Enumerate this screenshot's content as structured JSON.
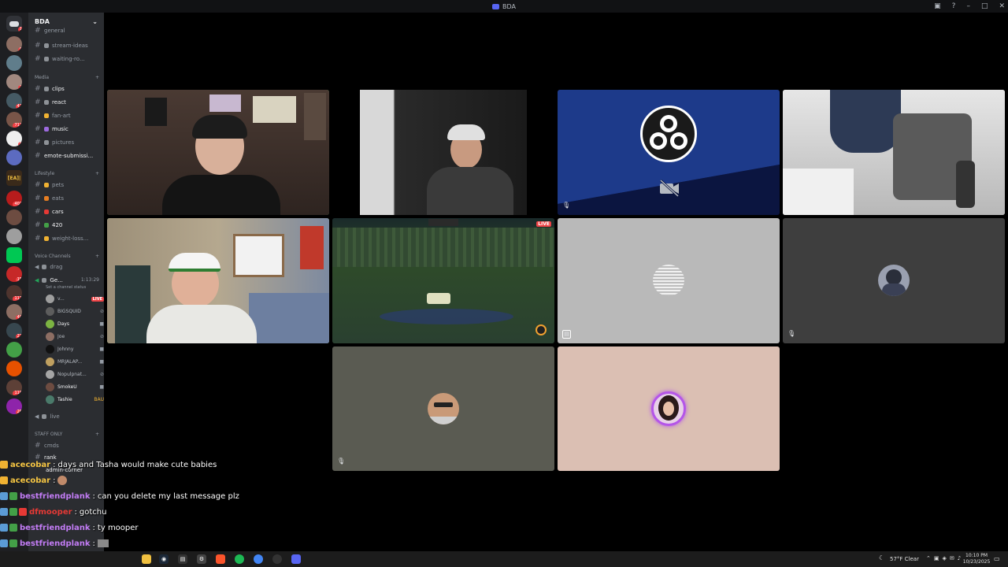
{
  "window": {
    "title": "BDA"
  },
  "server_rail": {
    "badges": [
      "1",
      "9",
      "3",
      "42",
      "712",
      "5",
      "402",
      "15",
      "111",
      "40",
      "22",
      "118",
      "26"
    ],
    "labels": [
      "[EA]|"
    ]
  },
  "sidebar": {
    "guild_name": "BDA",
    "top_channels": [
      {
        "name": "general"
      },
      {
        "name": "stream-ideas"
      },
      {
        "name": "waiting-ro..."
      }
    ],
    "categories": {
      "media": "Media",
      "lifestyle": "Lifestyle",
      "voice": "Voice Channels",
      "staff": "STAFF ONLY"
    },
    "media_channels": [
      {
        "name": "clips",
        "bright": true
      },
      {
        "name": "react",
        "bright": true
      },
      {
        "name": "fan-art",
        "bright": false
      },
      {
        "name": "music",
        "bright": true
      },
      {
        "name": "pictures",
        "bright": false
      },
      {
        "name": "emote-submissi...",
        "bright": true
      }
    ],
    "lifestyle_channels": [
      {
        "name": "pets",
        "bright": false
      },
      {
        "name": "eats",
        "bright": false
      },
      {
        "name": "cars",
        "bright": true
      },
      {
        "name": "420",
        "bright": true
      },
      {
        "name": "weight-loss...",
        "bright": false
      }
    ],
    "voice": {
      "drag": "drag",
      "active_channel": "Ge...",
      "active_time": "1:13:29",
      "status_hint": "Set a channel status",
      "live_channel": "live"
    },
    "voice_users": [
      {
        "name": "v...",
        "live": true,
        "live_label": "LIVE"
      },
      {
        "name": "BIGSQUID"
      },
      {
        "name": "Days"
      },
      {
        "name": "Joe"
      },
      {
        "name": "Johnny"
      },
      {
        "name": "MRJALAP..."
      },
      {
        "name": "Nopulpnat..."
      },
      {
        "name": "SmokeU"
      },
      {
        "name": "Tashie",
        "tag": "BAU"
      }
    ],
    "staff_channels": [
      {
        "name": "cmds"
      },
      {
        "name": "rank"
      },
      {
        "name": "admin-corner"
      }
    ]
  },
  "game_overlay": {
    "live_label": "LIVE"
  },
  "chat": {
    "messages": [
      {
        "user": "acecobar",
        "text": "days and Tasha would make cute babies",
        "color": "#f5c542"
      },
      {
        "user": "acecobar",
        "text": "",
        "color": "#f5c542"
      },
      {
        "user": "bestfriendplank",
        "text": "can you delete my last message plz",
        "color": "#c27cf5"
      },
      {
        "user": "dfmooper",
        "text": "gotchu",
        "color": "#e53935"
      },
      {
        "user": "bestfriendplank",
        "text": "ty mooper",
        "color": "#c27cf5"
      },
      {
        "user": "bestfriendplank",
        "text": "",
        "color": "#c27cf5"
      }
    ]
  },
  "taskbar": {
    "weather": "57°F  Clear",
    "time": "10:10 PM",
    "date": "10/23/2025"
  }
}
